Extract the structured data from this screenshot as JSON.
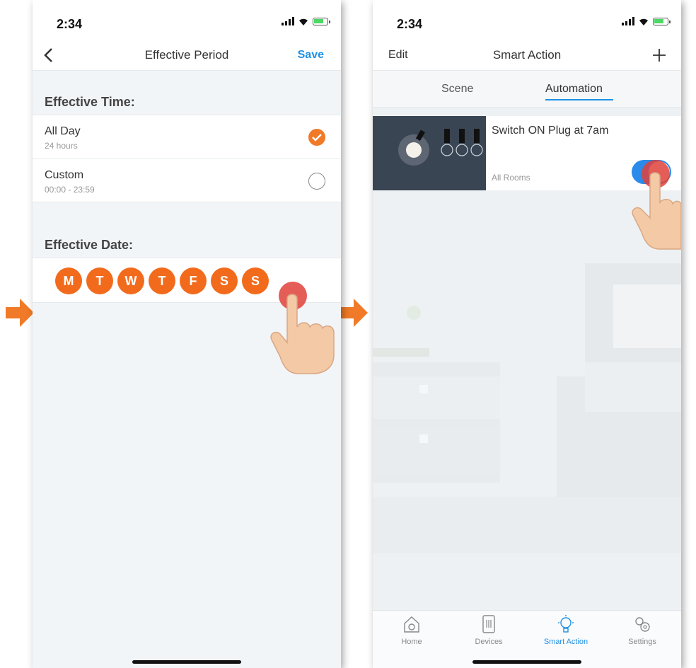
{
  "colors": {
    "accent_orange": "#f26b1d",
    "accent_blue": "#1e90e6",
    "toggle_blue": "#2a8bea",
    "arrow_orange": "#f07a27"
  },
  "left": {
    "status_time": "2:34",
    "nav": {
      "back_icon": "chevron-left-icon",
      "title": "Effective Period",
      "save_label": "Save"
    },
    "effective_time": {
      "label": "Effective Time:",
      "options": [
        {
          "title": "All Day",
          "subtitle": "24 hours",
          "selected": true
        },
        {
          "title": "Custom",
          "subtitle": "00:00 - 23:59",
          "selected": false
        }
      ]
    },
    "effective_date": {
      "label": "Effective Date:",
      "days": [
        "M",
        "T",
        "W",
        "T",
        "F",
        "S",
        "S"
      ]
    }
  },
  "right": {
    "status_time": "2:34",
    "nav": {
      "edit_label": "Edit",
      "title": "Smart Action",
      "add_icon": "plus-icon"
    },
    "tabs": [
      {
        "label": "Scene",
        "active": false
      },
      {
        "label": "Automation",
        "active": true
      }
    ],
    "automation": {
      "title": "Switch ON Plug at 7am",
      "room": "All Rooms",
      "enabled": true
    },
    "tabbar": [
      {
        "label": "Home",
        "icon": "home-icon",
        "active": false
      },
      {
        "label": "Devices",
        "icon": "devices-icon",
        "active": false
      },
      {
        "label": "Smart Action",
        "icon": "bulb-icon",
        "active": true
      },
      {
        "label": "Settings",
        "icon": "gears-icon",
        "active": false
      }
    ]
  }
}
